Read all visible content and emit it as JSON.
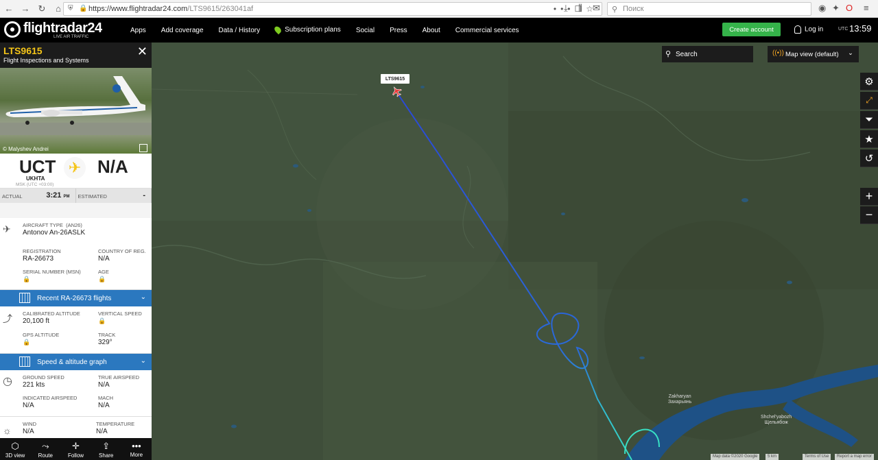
{
  "browser": {
    "url_host": "https://www.flightradar24.com",
    "url_path": "/LTS9615/263041af",
    "search_placeholder": "Поиск"
  },
  "nav": {
    "logo_text": "flightradar24",
    "logo_sub": "LIVE AIR TRAFFIC",
    "items": [
      "Apps",
      "Add coverage",
      "Data / History",
      "Subscription plans",
      "Social",
      "Press",
      "About",
      "Commercial services"
    ],
    "create_account": "Create account",
    "login": "Log in",
    "utc_label": "UTC",
    "clock": "13:59"
  },
  "flight": {
    "callsign": "LTS9615",
    "operator": "Flight Inspections and Systems",
    "photo_credit": "© Malyshev Andrei",
    "origin_code": "UCT",
    "origin_name": "UKHTA",
    "origin_tz": "MSK (UTC +03:00)",
    "destination_code": "N/A",
    "actual_label": "ACTUAL",
    "actual_time": "3:21",
    "actual_ampm": "PM",
    "estimated_label": "ESTIMATED",
    "estimated_value": "-"
  },
  "aircraft": {
    "type_label": "AIRCRAFT TYPE",
    "type_code": "(AN26)",
    "type_value": "Antonov An-26ASLK",
    "reg_label": "REGISTRATION",
    "reg_value": "RA-26673",
    "country_label": "COUNTRY OF REG.",
    "country_value": "N/A",
    "serial_label": "SERIAL NUMBER (MSN)",
    "age_label": "AGE"
  },
  "recent_bar": "Recent RA-26673 flights",
  "altitude": {
    "cal_label": "CALIBRATED ALTITUDE",
    "cal_value": "20,100 ft",
    "vs_label": "VERTICAL SPEED",
    "gps_label": "GPS ALTITUDE",
    "track_label": "TRACK",
    "track_value": "329°"
  },
  "speed_bar": "Speed & altitude graph",
  "speed": {
    "gs_label": "GROUND SPEED",
    "gs_value": "221 kts",
    "tas_label": "TRUE AIRSPEED",
    "tas_value": "N/A",
    "ias_label": "INDICATED AIRSPEED",
    "ias_value": "N/A",
    "mach_label": "MACH",
    "mach_value": "N/A"
  },
  "weather": {
    "wind_label": "WIND",
    "wind_value": "N/A",
    "temp_label": "TEMPERATURE",
    "temp_value": "N/A"
  },
  "bottom_bar": [
    "3D view",
    "Route",
    "Follow",
    "Share",
    "More"
  ],
  "map": {
    "search_label": "Search",
    "view_label": "Map view (default)",
    "aircraft_label": "LTS9615",
    "town1": "Zakharyan\nЗахарьянь",
    "town2": "Shchel'yabozh\nЩельябож",
    "attribution": [
      "Map data ©2020 Google",
      "5 km",
      "Terms of Use",
      "Report a map error"
    ]
  },
  "colors": {
    "accent_yellow": "#f5c518",
    "bar_blue": "#2b78bf",
    "track_blue": "#2a56d9",
    "track_cyan": "#38d6c8",
    "create_green": "#35b34a"
  }
}
